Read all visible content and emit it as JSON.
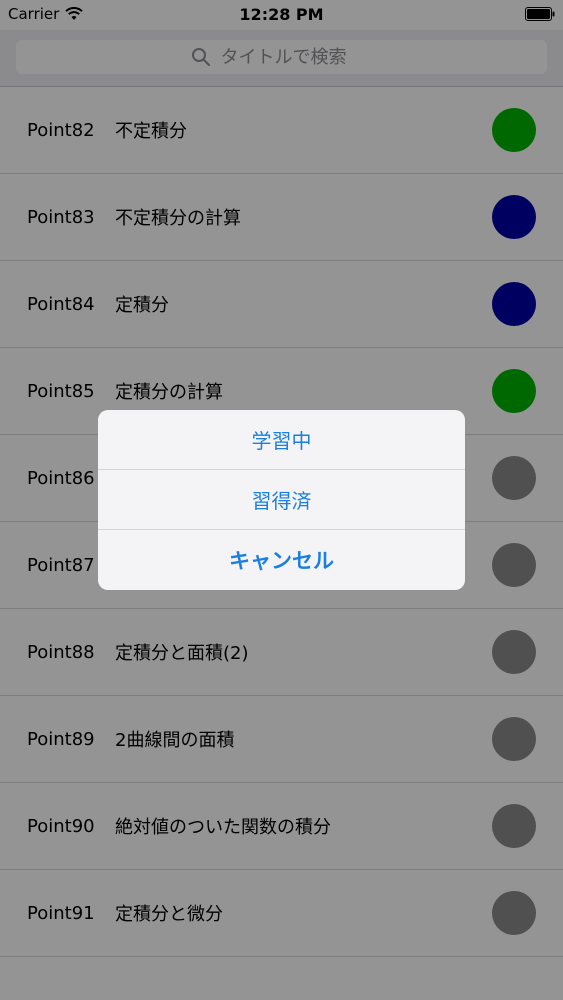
{
  "status_bar": {
    "carrier": "Carrier",
    "time": "12:28 PM"
  },
  "search": {
    "placeholder": "タイトルで検索"
  },
  "colors": {
    "learned": "#00b300",
    "learning": "#0000a8",
    "not_started": "#8a8a8a",
    "accent": "#1a7fe0"
  },
  "rows": [
    {
      "point": "Point82",
      "title": "不定積分",
      "status": "learned",
      "color": "#00b300"
    },
    {
      "point": "Point83",
      "title": "不定積分の計算",
      "status": "learning",
      "color": "#0000a8"
    },
    {
      "point": "Point84",
      "title": "定積分",
      "status": "learning",
      "color": "#0000a8"
    },
    {
      "point": "Point85",
      "title": "定積分の計算",
      "status": "learned",
      "color": "#00b300"
    },
    {
      "point": "Point86",
      "title": "",
      "status": "not_started",
      "color": "#8a8a8a"
    },
    {
      "point": "Point87",
      "title": "",
      "status": "not_started",
      "color": "#8a8a8a"
    },
    {
      "point": "Point88",
      "title": "定積分と面積(2)",
      "status": "not_started",
      "color": "#8a8a8a"
    },
    {
      "point": "Point89",
      "title": "2曲線間の面積",
      "status": "not_started",
      "color": "#8a8a8a"
    },
    {
      "point": "Point90",
      "title": "絶対値のついた関数の積分",
      "status": "not_started",
      "color": "#8a8a8a"
    },
    {
      "point": "Point91",
      "title": "定積分と微分",
      "status": "not_started",
      "color": "#8a8a8a"
    }
  ],
  "alert": {
    "options": [
      {
        "label": "学習中"
      },
      {
        "label": "習得済"
      },
      {
        "label": "キャンセル"
      }
    ]
  }
}
